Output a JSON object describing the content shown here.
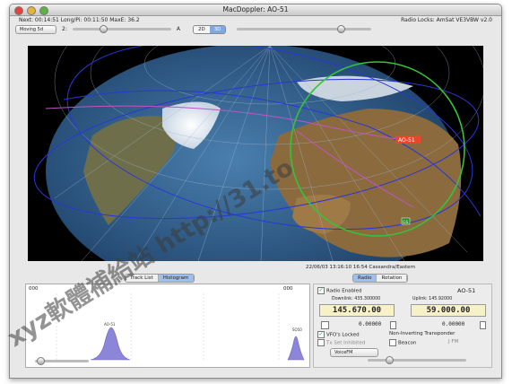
{
  "window": {
    "title": "MacDoppler: AO-51"
  },
  "info": {
    "left": "Next: 00:14:51  Long/Pi: 00:11:50 MaxE: 36.2",
    "right": "Radio Locks: AmSat VE3VBW v2.0"
  },
  "controls": {
    "mode_select": "Moving 5d",
    "mode_label": "2:",
    "view_options": [
      "2D",
      "3D"
    ],
    "view_selected": "3D",
    "zoom_label": "A"
  },
  "map": {
    "sat_label": "AO-51",
    "station_label": "GS",
    "colors": {
      "ocean": "#2a5a86",
      "land": "#8b6a3e",
      "footprint": "#34c437",
      "orbit": "#2a36d8",
      "track": "#c054c8"
    }
  },
  "status": {
    "text": "22/06/03 13:16:10  16:54 Cassandra/Eastern"
  },
  "left_tabs": [
    {
      "label": "Track List",
      "active": false
    },
    {
      "label": "Histogram",
      "active": true
    }
  ],
  "histogram": {
    "left_value": "000",
    "right_value": "000",
    "peak1_label": "AO-51",
    "peak2_label": "SO50"
  },
  "right_tabs": [
    {
      "label": "Radio",
      "active": true
    },
    {
      "label": "Rotation",
      "active": false
    }
  ],
  "radio": {
    "enabled_label": "Radio Enabled",
    "sat_name": "AO-51",
    "downlink_label": "Downlink: 435.300000",
    "uplink_label": "Uplink: 145.92000",
    "downlink_freq": "145.670.00",
    "uplink_freq": "59.000.00",
    "left_small": "0.00000",
    "right_small": "0.00000",
    "vfo_label": "VFO's Locked",
    "transponder_label": "Non-Inverting Transponder",
    "ctcss_label": "Tx Set Inhibited",
    "beacon_label": "Beacon",
    "fm_label": "J FM",
    "mode_select": "VoiceFM"
  },
  "watermark": {
    "text": "xyz軟體補給站 http://31.to"
  }
}
